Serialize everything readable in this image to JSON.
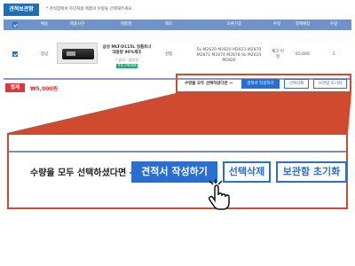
{
  "tab": {
    "label": "견적보관함"
  },
  "notice": "* 견적장에서 하단처럼 제품의 수량을 선택해주세요.",
  "table": {
    "headers": [
      "",
      "배송",
      "제품사진",
      "제품명",
      "제조",
      "호환기종",
      "수량",
      "결제예정",
      "수량"
    ],
    "rows": [
      {
        "checked": true,
        "delivery": "정상",
        "product_title": "삼성 MLT-D115L 정품토너 대용량 90%제조",
        "product_option": "* 옵션 : 옵션정",
        "product_tag": "전체 선택/해제",
        "maker": "검정",
        "compatible": "SL-M2620 M2820 M2821 M2870 M2871 M2874 M2878 SL-M2624 M2826",
        "qty": "재고 미정",
        "price": "65,000",
        "count": "1"
      }
    ]
  },
  "total": {
    "label": "합계",
    "amount": "₩5,000원"
  },
  "actions": {
    "prompt": "수량을 모두 선택하셨다면 →",
    "create_quote": "견적서 작성하기",
    "delete_selected": "선택삭제",
    "reset_storage": "보관함 초기화"
  },
  "colors": {
    "primary": "#2a6fd0",
    "header": "#6f93c9",
    "highlight": "#d04a2f",
    "total": "#d9363e"
  }
}
